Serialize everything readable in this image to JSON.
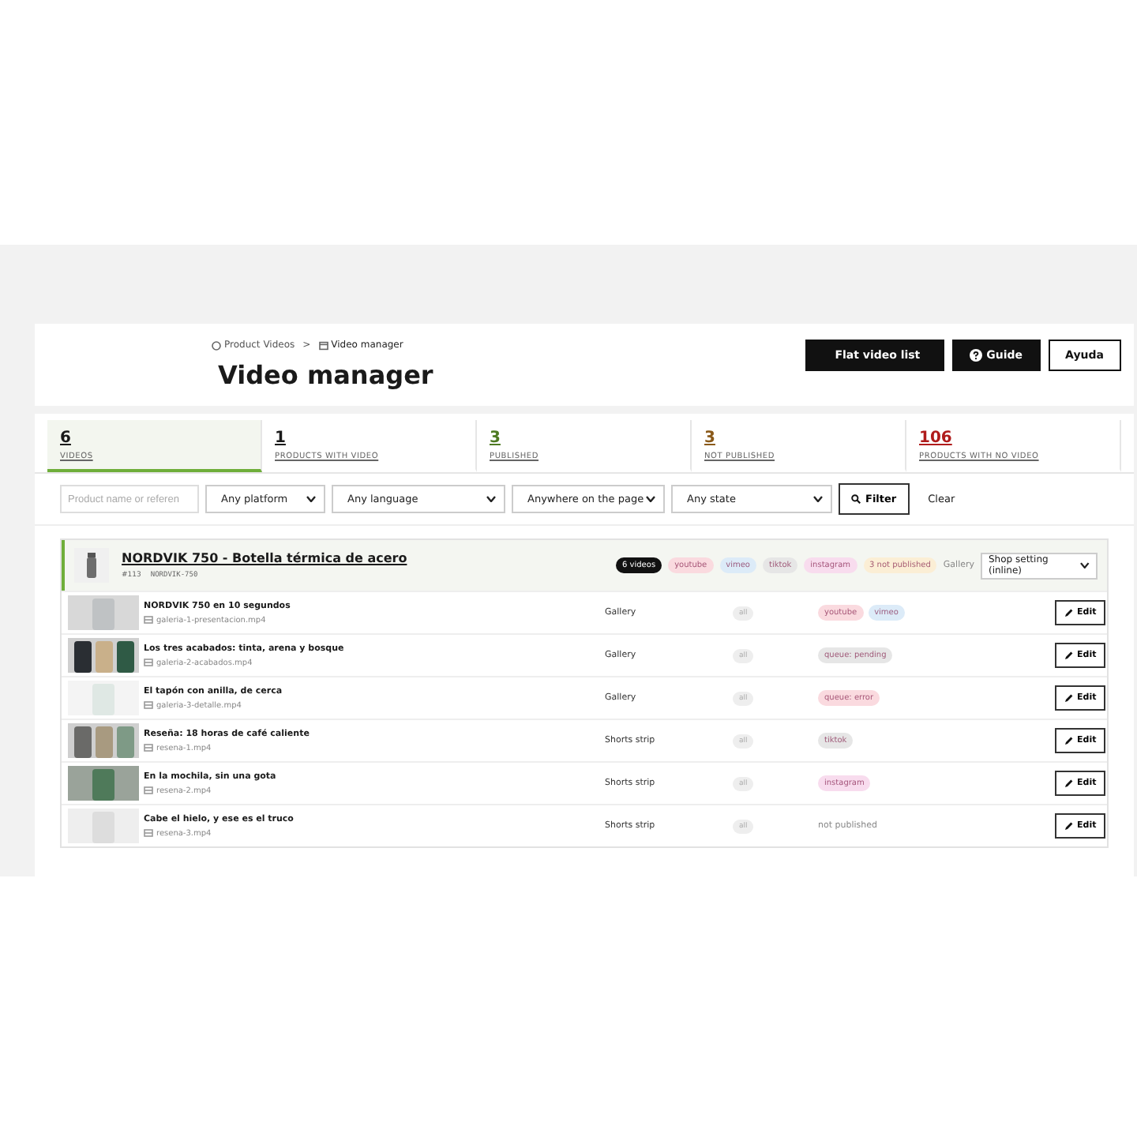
{
  "breadcrumb": [
    {
      "label": "Product Videos"
    },
    {
      "label": "Video manager"
    }
  ],
  "breadcrumb_separator": ">",
  "title": "Video manager",
  "header_buttons": [
    {
      "label": "Flat video list",
      "kind": "dark"
    },
    {
      "label": "Guide",
      "kind": "help"
    },
    {
      "label": "Ayuda",
      "kind": "outline"
    }
  ],
  "stats": [
    {
      "value": "6",
      "label": "VIDEOS",
      "selected": true,
      "color": "#1a1a1a"
    },
    {
      "value": "1",
      "label": "PRODUCTS WITH VIDEO",
      "selected": false,
      "color": "#1a1a1a"
    },
    {
      "value": "3",
      "label": "PUBLISHED",
      "selected": false,
      "color": "#4e7a22"
    },
    {
      "value": "3",
      "label": "NOT PUBLISHED",
      "selected": false,
      "color": "#8a5a1a"
    },
    {
      "value": "106",
      "label": "PRODUCTS WITH NO VIDEO",
      "selected": false,
      "color": "#b01c1c"
    }
  ],
  "filters": {
    "search_placeholder": "Product name or referen",
    "selects": [
      "Any platform",
      "Any language",
      "Anywhere on the page",
      "Any state"
    ],
    "filter_button": "Filter",
    "clear": "Clear"
  },
  "product": {
    "name": "NORDVIK 750 - Botella térmica de acero",
    "id": "#113",
    "ref": "NORDVIK-750",
    "count": "6 videos",
    "tags": [
      {
        "label": "youtube",
        "color": "#fadadf"
      },
      {
        "label": "vimeo",
        "color": "#dcebf8"
      },
      {
        "label": "tiktok",
        "color": "#e6e6e6"
      },
      {
        "label": "instagram",
        "color": "#f8dcee"
      },
      {
        "label": "3 not published",
        "color": "#fbeed5"
      }
    ],
    "gallery_label": "Gallery",
    "gallery_setting": "Shop setting (inline)"
  },
  "videos": [
    {
      "title": "NORDVIK 750 en 10 segundos",
      "file": "galeria-1-presentacion.mp4",
      "placement": "Gallery",
      "language": "all",
      "tags": [
        {
          "label": "youtube",
          "color": "#fadadf"
        },
        {
          "label": "vimeo",
          "color": "#dcebf8"
        }
      ],
      "edit": "Edit"
    },
    {
      "title": "Los tres acabados: tinta, arena y bosque",
      "file": "galeria-2-acabados.mp4",
      "placement": "Gallery",
      "language": "all",
      "tags": [
        {
          "label": "queue: pending",
          "color": "#e6e6e6"
        }
      ],
      "edit": "Edit"
    },
    {
      "title": "El tapón con anilla, de cerca",
      "file": "galeria-3-detalle.mp4",
      "placement": "Gallery",
      "language": "all",
      "tags": [
        {
          "label": "queue: error",
          "color": "#fadadf"
        }
      ],
      "edit": "Edit"
    },
    {
      "title": "Reseña: 18 horas de café caliente",
      "file": "resena-1.mp4",
      "placement": "Shorts strip",
      "language": "all",
      "tags": [
        {
          "label": "tiktok",
          "color": "#e6e6e6"
        }
      ],
      "edit": "Edit"
    },
    {
      "title": "En la mochila, sin una gota",
      "file": "resena-2.mp4",
      "placement": "Shorts strip",
      "language": "all",
      "tags": [
        {
          "label": "instagram",
          "color": "#f8dcee"
        }
      ],
      "edit": "Edit"
    },
    {
      "title": "Cabe el hielo, y ese es el truco",
      "file": "resena-3.mp4",
      "placement": "Shorts strip",
      "language": "all",
      "status_text": "not published",
      "edit": "Edit"
    }
  ]
}
